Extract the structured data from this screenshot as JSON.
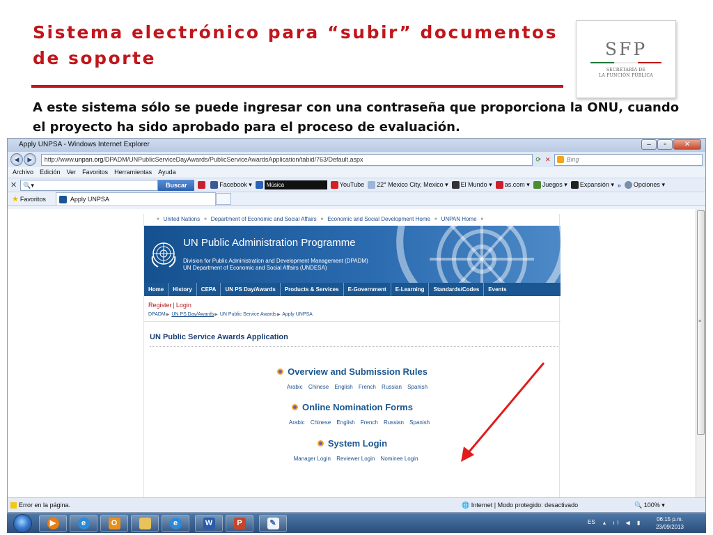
{
  "slide": {
    "title": "Sistema electrónico para “subir” documentos de soporte",
    "body": "A este sistema sólo se puede ingresar con una contraseña que proporciona la ONU, cuando el proyecto ha sido aprobado para el proceso de evaluación.",
    "logo": {
      "mark": "SFP",
      "subtitle_line1": "SECRETARÍA DE",
      "subtitle_line2": "LA FUNCIÓN PÚBLICA",
      "colors": [
        "#1f7a3a",
        "#ffffff",
        "#c0161c"
      ]
    },
    "accent_color": "#c0161c"
  },
  "browser": {
    "window_title": "Apply UNPSA - Windows Internet Explorer",
    "url_prefix": "http://www.",
    "url_domain": "unpan.org",
    "url_path": "/DPADM/UNPublicServiceDayAwards/PublicServiceAwardsApplication/tabid/763/Default.aspx",
    "search_engine": "Bing",
    "menu": [
      "Archivo",
      "Edición",
      "Ver",
      "Favoritos",
      "Herramientas",
      "Ayuda"
    ],
    "toolbar": {
      "search_button": "Buscar",
      "items": {
        "facebook": "Facebook",
        "music": "Música",
        "youtube": "YouTube",
        "weather": "22° Mexico City, Mexico",
        "elmundo": "El Mundo",
        "ascom": "as.com",
        "juegos": "Juegos",
        "expansion": "Expansión",
        "options": "Opciones"
      }
    },
    "favorites_label": "Favoritos",
    "tab_label": "Apply UNPSA",
    "status": {
      "left": "Error en la página.",
      "zone": "Internet | Modo protegido: desactivado",
      "zoom": "100%"
    }
  },
  "unpan": {
    "top_links": [
      "United Nations",
      "Department of Economic and Social Affairs",
      "Economic and Social Development Home",
      "UNPAN Home"
    ],
    "banner_title": "UN Public Administration Programme",
    "banner_sub1": "Division for Public Administration and Development Management (DPADM)",
    "banner_sub2": "UN Department of Economic and Social Affairs (UNDESA)",
    "nav": [
      "Home",
      "History",
      "CEPA",
      "UN PS Day/Awards",
      "Products & Services",
      "E-Government",
      "E-Learning",
      "Standards/Codes",
      "Events"
    ],
    "register": "Register",
    "login": "Login",
    "breadcrumb": [
      "DPADM",
      "UN PS Day/Awards",
      "UN Public Service Awards",
      "Apply UNPSA"
    ],
    "page_heading": "UN Public Service Awards Application",
    "sections": [
      {
        "title": "Overview and Submission Rules",
        "links": [
          "Arabic",
          "Chinese",
          "English",
          "French",
          "Russian",
          "Spanish"
        ]
      },
      {
        "title": "Online Nomination Forms",
        "links": [
          "Arabic",
          "Chinese",
          "English",
          "French",
          "Russian",
          "Spanish"
        ]
      },
      {
        "title": "System Login",
        "links": [
          "Manager Login",
          "Reviewer Login",
          "Nominee Login"
        ]
      }
    ]
  },
  "taskbar": {
    "language": "ES",
    "time": "06:15 p.m.",
    "date": "23/09/2013"
  }
}
